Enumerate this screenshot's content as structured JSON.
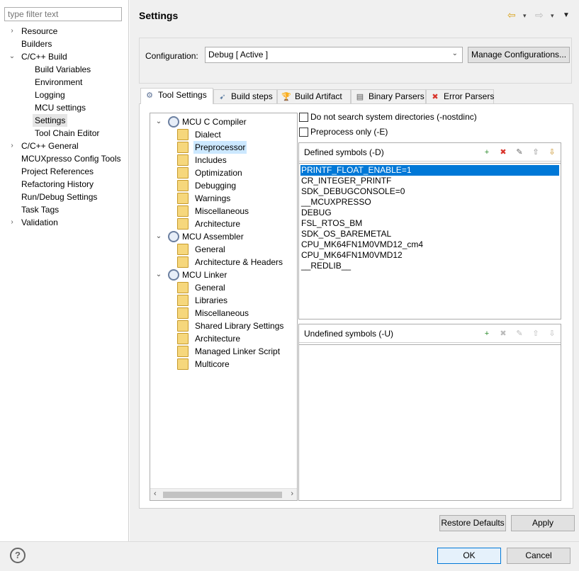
{
  "sidebar": {
    "filter_placeholder": "type filter text",
    "items": [
      {
        "label": "Resource",
        "expander": "›"
      },
      {
        "label": "Builders",
        "expander": ""
      },
      {
        "label": "C/C++ Build",
        "expander": "⌄"
      },
      {
        "label": "Build Variables",
        "expander": ""
      },
      {
        "label": "Environment",
        "expander": ""
      },
      {
        "label": "Logging",
        "expander": ""
      },
      {
        "label": "MCU settings",
        "expander": ""
      },
      {
        "label": "Settings",
        "expander": ""
      },
      {
        "label": "Tool Chain Editor",
        "expander": ""
      },
      {
        "label": "C/C++ General",
        "expander": "›"
      },
      {
        "label": "MCUXpresso Config Tools",
        "expander": ""
      },
      {
        "label": "Project References",
        "expander": ""
      },
      {
        "label": "Refactoring History",
        "expander": ""
      },
      {
        "label": "Run/Debug Settings",
        "expander": ""
      },
      {
        "label": "Task Tags",
        "expander": ""
      },
      {
        "label": "Validation",
        "expander": "›"
      }
    ]
  },
  "header": {
    "title": "Settings",
    "back_icon": "⇦",
    "forward_icon": "⇨",
    "dropdown_icon": "▾",
    "menu_icon": "▼"
  },
  "configuration": {
    "label": "Configuration:",
    "selected": "Debug  [ Active ]",
    "manage_button": "Manage Configurations..."
  },
  "tabs": [
    {
      "label": "Tool Settings",
      "icon": "⚙"
    },
    {
      "label": "Build steps",
      "icon": "➹"
    },
    {
      "label": "Build Artifact",
      "icon": "🏆"
    },
    {
      "label": "Binary Parsers",
      "icon": "▤"
    },
    {
      "label": "Error Parsers",
      "icon": "✖"
    }
  ],
  "tool_tree": {
    "expanded_icon": "⌄",
    "nodes": [
      {
        "label": "MCU C Compiler"
      },
      {
        "label": "Dialect"
      },
      {
        "label": "Preprocessor"
      },
      {
        "label": "Includes"
      },
      {
        "label": "Optimization"
      },
      {
        "label": "Debugging"
      },
      {
        "label": "Warnings"
      },
      {
        "label": "Miscellaneous"
      },
      {
        "label": "Architecture"
      },
      {
        "label": "MCU Assembler"
      },
      {
        "label": "General"
      },
      {
        "label": "Architecture & Headers"
      },
      {
        "label": "MCU Linker"
      },
      {
        "label": "General"
      },
      {
        "label": "Libraries"
      },
      {
        "label": "Miscellaneous"
      },
      {
        "label": "Shared Library Settings"
      },
      {
        "label": "Architecture"
      },
      {
        "label": "Managed Linker Script"
      },
      {
        "label": "Multicore"
      }
    ],
    "scroll_left": "‹",
    "scroll_right": "›"
  },
  "options": {
    "nostdinc_label": "Do not search system directories (-nostdinc)",
    "preprocess_only_label": "Preprocess only (-E)"
  },
  "defined_symbols": {
    "title": "Defined symbols (-D)",
    "items": [
      "PRINTF_FLOAT_ENABLE=1",
      "CR_INTEGER_PRINTF",
      "SDK_DEBUGCONSOLE=0",
      "__MCUXPRESSO",
      "DEBUG",
      "FSL_RTOS_BM",
      "SDK_OS_BAREMETAL",
      "CPU_MK64FN1M0VMD12_cm4",
      "CPU_MK64FN1M0VMD12",
      "__REDLIB__"
    ]
  },
  "undefined_symbols": {
    "title": "Undefined symbols (-U)",
    "items": []
  },
  "toolbar_icons": {
    "add": "+",
    "delete": "✖",
    "edit": "✎",
    "up": "⇧",
    "down": "⇩"
  },
  "buttons": {
    "restore_defaults": "Restore Defaults",
    "apply": "Apply",
    "ok": "OK",
    "cancel": "Cancel",
    "help": "?"
  },
  "colors": {
    "selection": "#0078d7",
    "tree_selection": "#cce8ff",
    "panel_bg": "#f0f0f0"
  }
}
